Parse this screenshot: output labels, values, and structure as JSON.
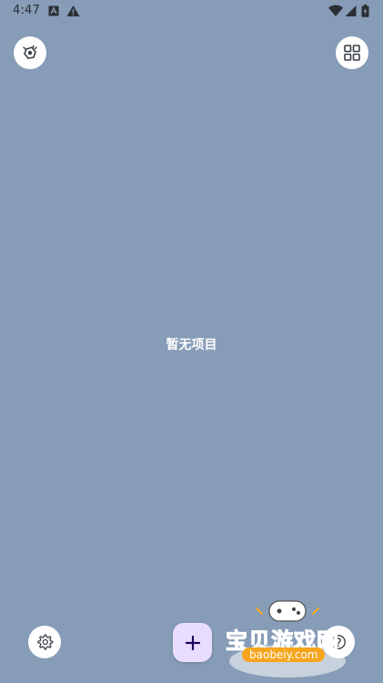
{
  "status_bar": {
    "time": "4:47",
    "icons": [
      "a-notification-icon",
      "warning-icon",
      "wifi-icon",
      "signal-icon",
      "battery-icon"
    ]
  },
  "toolbar": {
    "left_icon": "appearance-icon",
    "right_icon": "grid-view-icon"
  },
  "main": {
    "empty_text": "暂无项目"
  },
  "bottom_bar": {
    "settings_icon": "gear-icon",
    "add_icon": "plus-icon",
    "right_icon": "help-icon"
  },
  "watermark": {
    "title": "宝贝游戏网",
    "url": "baobeiy.com"
  },
  "colors": {
    "background": "#869cb7",
    "fab": "#e9ddff",
    "fab_icon": "#21005d",
    "watermark": "#f6a51c"
  }
}
